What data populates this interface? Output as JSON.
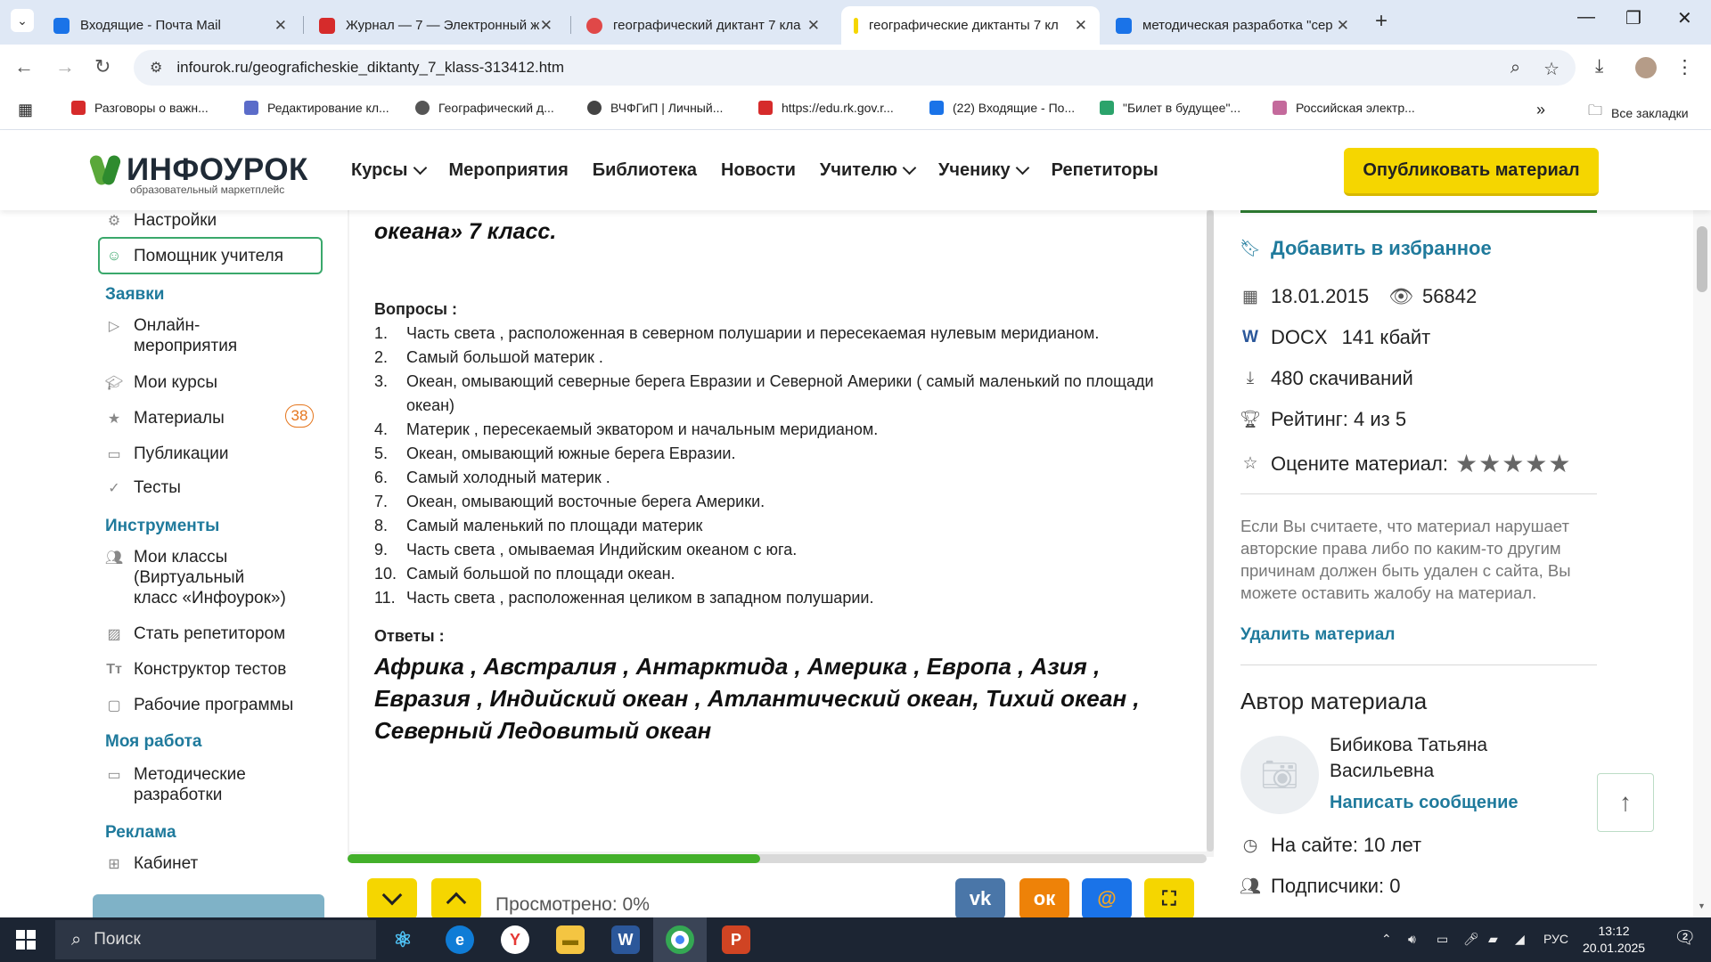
{
  "browser": {
    "tabs": [
      {
        "title": "Входящие - Почта Mail",
        "color": "#1a73e8"
      },
      {
        "title": "Журнал — 7 — Электронный ж",
        "color": "#d62b2b"
      },
      {
        "title": "географический диктант 7 кла",
        "color": "#e04848"
      },
      {
        "title": "географические диктанты 7 кл",
        "color": "#f5d600"
      },
      {
        "title": "методическая разработка \"сер",
        "color": "#1a73e8"
      }
    ],
    "url": "infourok.ru/geograficheskie_diktanty_7_klass-313412.htm",
    "bookmarks": [
      {
        "label": "Разговоры о важн...",
        "color": "#d62b2b"
      },
      {
        "label": "Редактирование кл...",
        "color": "#5b6cc9"
      },
      {
        "label": "Географический д...",
        "color": "#555555"
      },
      {
        "label": "ВЧФГиП | Личный...",
        "color": "#444444"
      },
      {
        "label": "https://edu.rk.gov.r...",
        "color": "#d62b2b"
      },
      {
        "label": "(22) Входящие - По...",
        "color": "#1a73e8"
      },
      {
        "label": "\"Билет в будущее\"...",
        "color": "#2ba36b"
      },
      {
        "label": "Российская электр...",
        "color": "#c46a9c"
      }
    ],
    "all_bookmarks": "Все закладки"
  },
  "site": {
    "logo": "ИНФОУРОК",
    "logo_sub": "образовательный маркетплейс",
    "menu": [
      "Курсы",
      "Мероприятия",
      "Библиотека",
      "Новости",
      "Учителю",
      "Ученику",
      "Репетиторы"
    ],
    "publish": "Опубликовать материал"
  },
  "sidebar": {
    "settings": "Настройки",
    "assistant": "Помощник учителя",
    "head_requests": "Заявки",
    "online": "Онлайн-\nмероприятия",
    "my_courses": "Мои курсы",
    "materials": "Материалы",
    "materials_count": "38",
    "publications": "Публикации",
    "tests": "Тесты",
    "head_tools": "Инструменты",
    "my_classes": "Мои классы\n(Виртуальный\nкласс «Инфоурок»)",
    "tutor": "Стать репетитором",
    "test_builder": "Конструктор тестов",
    "work_programs": "Рабочие программы",
    "head_my_work": "Моя работа",
    "method_dev": "Методические\nразработки",
    "head_ads": "Реклама",
    "cabinet": "Кабинет"
  },
  "document": {
    "title": "океана»   7 класс.",
    "questions_head": "Вопросы :",
    "questions": [
      {
        "n": "1.",
        "text": "Часть света , расположенная в северном полушарии и пересекаемая нулевым меридианом."
      },
      {
        "n": "2.",
        "text": "Самый большой  материк ."
      },
      {
        "n": "3.",
        "text": "Океан, омывающий северные берега Евразии и Северной Америки ( самый маленький по площади океан)"
      },
      {
        "n": "4.",
        "text": "Материк , пересекаемый экватором и начальным меридианом."
      },
      {
        "n": "5.",
        "text": "Океан, омывающий южные берега Евразии."
      },
      {
        "n": "6.",
        "text": "Самый холодный материк ."
      },
      {
        "n": "7.",
        "text": "Океан, омывающий восточные берега Америки."
      },
      {
        "n": "8.",
        "text": "Самый маленький по площади материк"
      },
      {
        "n": "9.",
        "text": "Часть света , омываемая Индийским океаном с юга."
      },
      {
        "n": "10.",
        "text": "Самый большой по площади океан."
      },
      {
        "n": "11.",
        "text": "Часть света , расположенная целиком в западном полушарии."
      }
    ],
    "answers_head": "Ответы :",
    "answers": "  Африка , Австралия , Антарктида , Америка , Европа , Азия , Евразия , Индийский океан , Атлантический океан, Тихий океан , Северный Ледовитый океан",
    "progress": 0.48,
    "viewed": "Просмотрено: 0%"
  },
  "info": {
    "favorite": "Добавить в избранное",
    "date": "18.01.2015",
    "views": "56842",
    "format": "DOCX",
    "size": "141 кбайт",
    "downloads": "480 скачиваний",
    "rating": "Рейтинг: 4 из 5",
    "rate_prompt": "Оцените материал:",
    "complaint": "Если Вы считаете, что материал нарушает авторские права либо по каким-то другим причинам должен быть удален с сайта, Вы можете оставить жалобу на материал.",
    "delete": "Удалить материал",
    "author_title": "Автор материала",
    "author_name": "Бибикова Татьяна Васильевна",
    "write_message": "Написать сообщение",
    "on_site": "На сайте: 10 лет",
    "subscribers": "Подписчики: 0"
  },
  "taskbar": {
    "search": "Поиск",
    "lang": "РУС",
    "time": "13:12",
    "date": "20.01.2025",
    "notifications": "2"
  },
  "colors": {
    "accent": "#1f7a9c",
    "brand_yellow": "#f5d600",
    "green": "#43b02a",
    "orange": "#e5761d"
  }
}
